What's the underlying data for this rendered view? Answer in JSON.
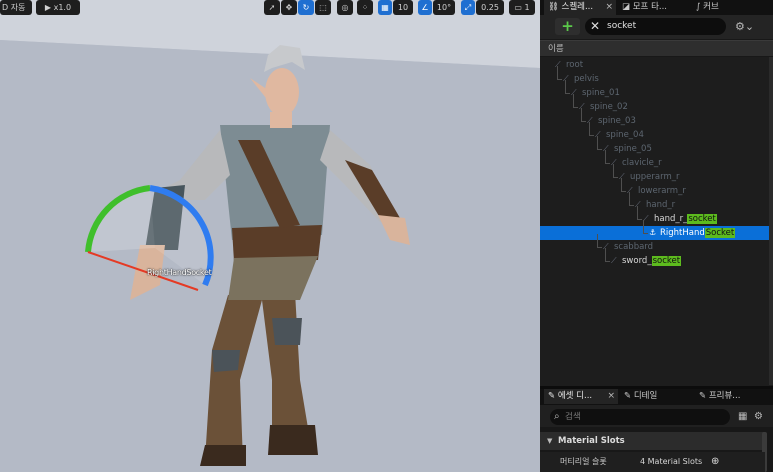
{
  "viewport": {
    "toolbar": {
      "mode_label": "D 자동",
      "speed_label": "x1.0",
      "grid_snap_value": "10",
      "angle_snap_value": "10°",
      "scale_snap_value": "0.25",
      "camera_speed_value": "1"
    },
    "socket_label": "RightHandSocket"
  },
  "tabs_top": [
    {
      "label": "스켈레...",
      "close": "×"
    },
    {
      "label": "모프 타..."
    },
    {
      "label": "커브"
    }
  ],
  "search": {
    "value": "socket",
    "clear": "✕",
    "add": "+",
    "settings": "⚙⌄"
  },
  "tree": {
    "header": "이름",
    "rows": [
      {
        "label": "root"
      },
      {
        "label": "pelvis"
      },
      {
        "label": "spine_01"
      },
      {
        "label": "spine_02"
      },
      {
        "label": "spine_03"
      },
      {
        "label": "spine_04"
      },
      {
        "label": "spine_05"
      },
      {
        "label": "clavicle_r"
      },
      {
        "label": "upperarm_r"
      },
      {
        "label": "lowerarm_r"
      },
      {
        "label": "hand_r"
      },
      {
        "label": "hand_r_",
        "match": "socket"
      },
      {
        "label": "RightHand",
        "match": "Socket"
      },
      {
        "label": "scabbard"
      },
      {
        "label": "sword_",
        "match": "socket"
      }
    ]
  },
  "tabs_bottom": [
    {
      "label": "에셋 디...",
      "close": "×"
    },
    {
      "label": "디테일"
    },
    {
      "label": "프리뷰..."
    }
  ],
  "details": {
    "search_placeholder": "검색",
    "section_title": "Material Slots",
    "row_label": "머티리얼 슬롯",
    "row_value": "4 Material Slots"
  },
  "colors": {
    "selection": "#0a6fd8",
    "highlight": "#5dbb1e",
    "gizmo_green": "#3fbf2b",
    "gizmo_blue": "#2f7cf0",
    "gizmo_red": "#e53a24"
  }
}
